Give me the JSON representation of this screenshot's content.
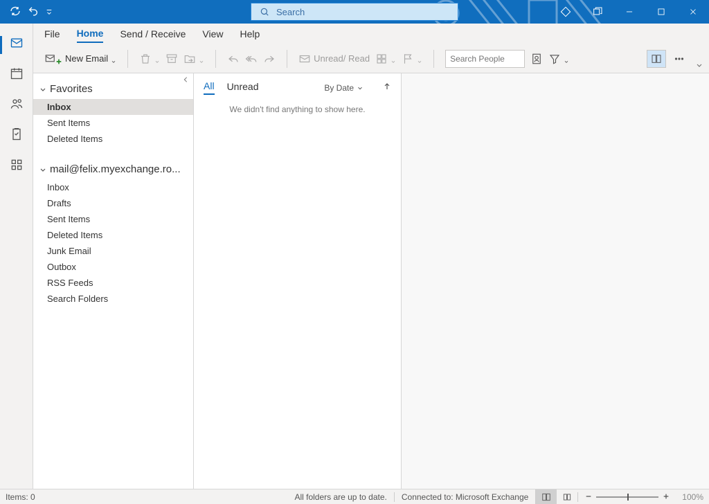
{
  "search": {
    "placeholder": "Search"
  },
  "tabs": {
    "file": "File",
    "home": "Home",
    "sendreceive": "Send / Receive",
    "view": "View",
    "help": "Help"
  },
  "ribbon": {
    "new_email": "New Email",
    "unread_read": "Unread/ Read",
    "search_people_placeholder": "Search People"
  },
  "folders": {
    "favorites_header": "Favorites",
    "favorites": [
      {
        "label": "Inbox",
        "selected": true
      },
      {
        "label": "Sent Items",
        "selected": false
      },
      {
        "label": "Deleted Items",
        "selected": false
      }
    ],
    "account_header": "mail@felix.myexchange.ro...",
    "account": [
      {
        "label": "Inbox"
      },
      {
        "label": "Drafts"
      },
      {
        "label": "Sent Items"
      },
      {
        "label": "Deleted Items"
      },
      {
        "label": "Junk Email"
      },
      {
        "label": "Outbox"
      },
      {
        "label": "RSS Feeds"
      },
      {
        "label": "Search Folders"
      }
    ]
  },
  "messagelist": {
    "tab_all": "All",
    "tab_unread": "Unread",
    "sort_label": "By Date",
    "empty": "We didn't find anything to show here."
  },
  "statusbar": {
    "items": "Items: 0",
    "sync": "All folders are up to date.",
    "connection": "Connected to: Microsoft Exchange",
    "zoom": "100%"
  }
}
